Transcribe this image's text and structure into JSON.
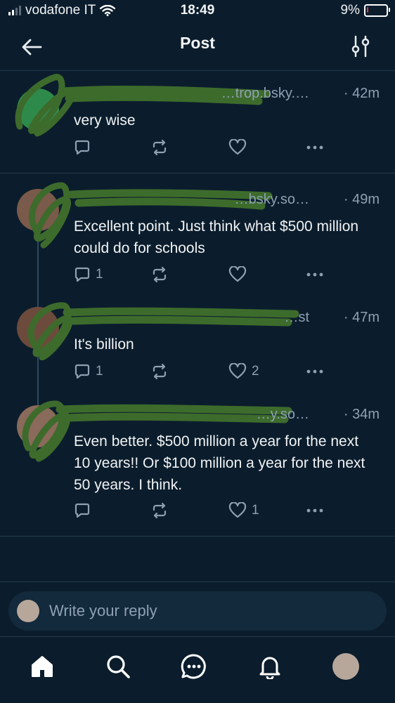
{
  "status_bar": {
    "carrier": "vodafone IT",
    "time": "18:49",
    "battery_percent": "9%",
    "battery_level": 0.09
  },
  "header": {
    "title": "Post"
  },
  "posts": [
    {
      "handle": "…trop.bsky.…",
      "time": "· 42m",
      "text": "very wise",
      "reply_count": "",
      "like_count": ""
    },
    {
      "handle": "…bsky.so…",
      "time": "· 49m",
      "text": "Excellent point. Just think what $500 million could do for schools",
      "reply_count": "1",
      "like_count": ""
    },
    {
      "handle": "…st",
      "time": "· 47m",
      "text": "It's billion",
      "reply_count": "1",
      "like_count": "2"
    },
    {
      "handle": "…y.so…",
      "time": "· 34m",
      "text": "Even better. $500 million a year for the next 10 years!! Or $100 million a year for the next 50 years. I think.",
      "reply_count": "",
      "like_count": "1"
    }
  ],
  "reply": {
    "placeholder": "Write your reply"
  },
  "tabs": [
    "home-icon",
    "search-icon",
    "chat-icon",
    "bell-icon",
    "profile-avatar"
  ],
  "colors": {
    "background": "#0b1d2c",
    "muted": "#8ea1b3",
    "scribble": "#3d6b2c",
    "accent": "#1d8cf8"
  }
}
